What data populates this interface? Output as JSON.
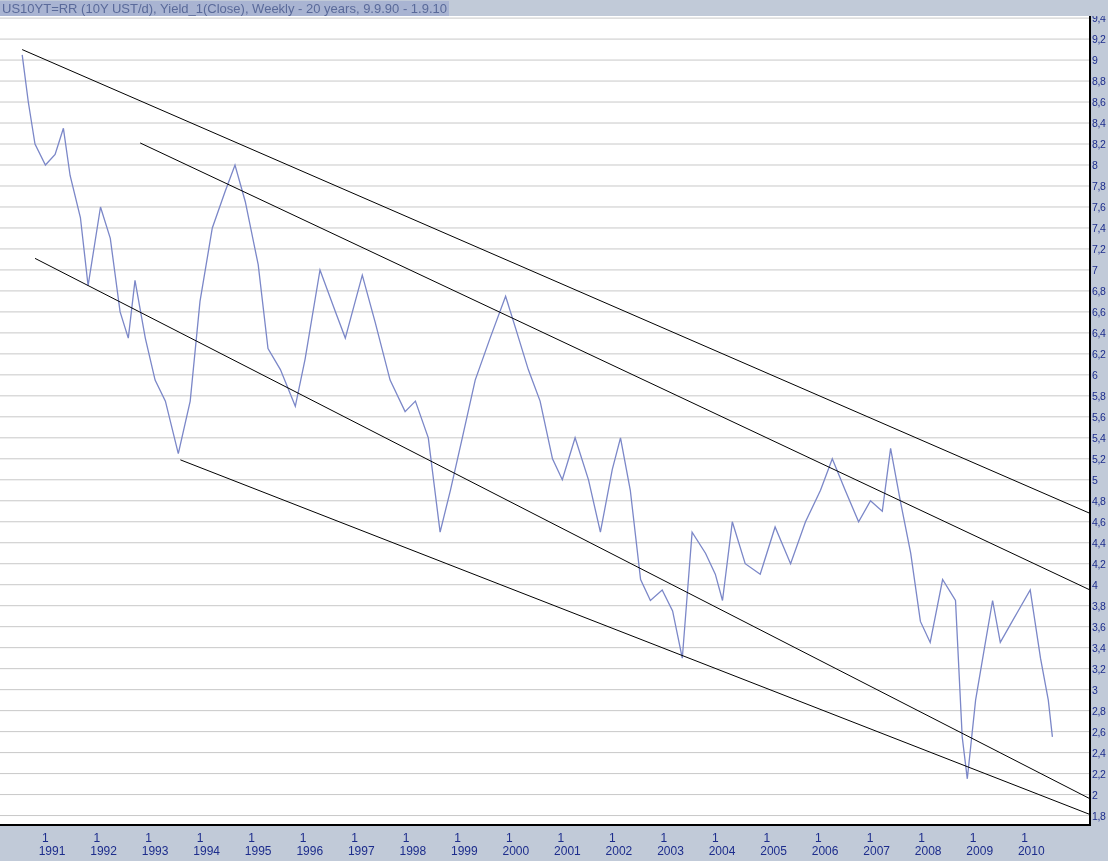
{
  "title_bar": {
    "text": "US10YT=RR (10Y UST/d), Yield_1(Close), Weekly - 20 years, 9.9.90 - 1.9.10"
  },
  "chart": {
    "chart_data": {
      "type": "line",
      "x": [
        1990.42,
        1990.54,
        1990.67,
        1990.87,
        1991.06,
        1991.22,
        1991.35,
        1991.55,
        1991.7,
        1991.94,
        1992.13,
        1992.32,
        1992.48,
        1992.61,
        1992.81,
        1993.0,
        1993.2,
        1993.45,
        1993.68,
        1993.87,
        1994.11,
        1994.36,
        1994.55,
        1994.75,
        1995.0,
        1995.19,
        1995.43,
        1995.72,
        1995.91,
        1996.2,
        1996.5,
        1996.69,
        1997.02,
        1997.27,
        1997.56,
        1997.85,
        1998.05,
        1998.3,
        1998.53,
        1998.73,
        1998.96,
        1999.21,
        1999.5,
        1999.8,
        1999.99,
        2000.24,
        2000.47,
        2000.71,
        2000.9,
        2001.15,
        2001.41,
        2001.64,
        2001.87,
        2002.03,
        2002.22,
        2002.42,
        2002.61,
        2002.84,
        2003.04,
        2003.23,
        2003.42,
        2003.68,
        2003.87,
        2004.01,
        2004.2,
        2004.45,
        2004.74,
        2005.03,
        2005.33,
        2005.62,
        2005.91,
        2006.14,
        2006.39,
        2006.65,
        2006.88,
        2007.11,
        2007.27,
        2007.46,
        2007.66,
        2007.85,
        2008.04,
        2008.28,
        2008.53,
        2008.66,
        2008.76,
        2008.92,
        2009.11,
        2009.25,
        2009.4,
        2009.63,
        2009.98,
        2010.18,
        2010.33,
        2010.41
      ],
      "series": [
        {
          "color": "#7b87c8",
          "values": [
            9.05,
            8.6,
            8.2,
            8.0,
            8.1,
            8.35,
            7.9,
            7.5,
            6.85,
            7.6,
            7.3,
            6.6,
            6.35,
            6.9,
            6.35,
            5.95,
            5.75,
            5.25,
            5.75,
            6.7,
            7.4,
            7.75,
            8.0,
            7.65,
            7.05,
            6.25,
            6.05,
            5.7,
            6.15,
            7.0,
            6.6,
            6.35,
            6.95,
            6.5,
            5.95,
            5.65,
            5.75,
            5.4,
            4.5,
            4.9,
            5.4,
            5.95,
            6.35,
            6.75,
            6.45,
            6.05,
            5.75,
            5.2,
            5.0,
            5.4,
            5.0,
            4.5,
            5.1,
            5.4,
            4.9,
            4.05,
            3.85,
            3.95,
            3.75,
            3.3,
            4.5,
            4.3,
            4.1,
            3.85,
            4.6,
            4.2,
            4.1,
            4.55,
            4.2,
            4.6,
            4.9,
            5.2,
            4.9,
            4.6,
            4.8,
            4.7,
            5.3,
            4.8,
            4.3,
            3.65,
            3.45,
            4.05,
            3.85,
            2.55,
            2.15,
            2.9,
            3.45,
            3.85,
            3.45,
            3.65,
            3.95,
            3.3,
            2.9,
            2.55
          ]
        }
      ],
      "xlim": [
        1989.99,
        2011.14
      ],
      "grid": true,
      "ylim": [
        1.71,
        9.42
      ],
      "yticks": [
        {
          "value": 9.4,
          "label": "9,4"
        },
        {
          "value": 9.2,
          "label": "9,2"
        },
        {
          "value": 9,
          "label": "9"
        },
        {
          "value": 8.8,
          "label": "8,8"
        },
        {
          "value": 8.6,
          "label": "8,6"
        },
        {
          "value": 8.4,
          "label": "8,4"
        },
        {
          "value": 8.2,
          "label": "8,2"
        },
        {
          "value": 8,
          "label": "8"
        },
        {
          "value": 7.8,
          "label": "7,8"
        },
        {
          "value": 7.6,
          "label": "7,6"
        },
        {
          "value": 7.4,
          "label": "7,4"
        },
        {
          "value": 7.2,
          "label": "7,2"
        },
        {
          "value": 7,
          "label": "7"
        },
        {
          "value": 6.8,
          "label": "6,8"
        },
        {
          "value": 6.6,
          "label": "6,6"
        },
        {
          "value": 6.4,
          "label": "6,4"
        },
        {
          "value": 6.2,
          "label": "6,2"
        },
        {
          "value": 6,
          "label": "6"
        },
        {
          "value": 5.8,
          "label": "5,8"
        },
        {
          "value": 5.6,
          "label": "5,6"
        },
        {
          "value": 5.4,
          "label": "5,4"
        },
        {
          "value": 5.2,
          "label": "5,2"
        },
        {
          "value": 5,
          "label": "5"
        },
        {
          "value": 4.8,
          "label": "4,8"
        },
        {
          "value": 4.6,
          "label": "4,6"
        },
        {
          "value": 4.4,
          "label": "4,4"
        },
        {
          "value": 4.2,
          "label": "4,2"
        },
        {
          "value": 4,
          "label": "4"
        },
        {
          "value": 3.8,
          "label": "3,8"
        },
        {
          "value": 3.6,
          "label": "3,6"
        },
        {
          "value": 3.4,
          "label": "3,4"
        },
        {
          "value": 3.2,
          "label": "3,2"
        },
        {
          "value": 3,
          "label": "3"
        },
        {
          "value": 2.8,
          "label": "2,8"
        },
        {
          "value": 2.6,
          "label": "2,6"
        },
        {
          "value": 2.4,
          "label": "2,4"
        },
        {
          "value": 2.2,
          "label": "2,2"
        },
        {
          "value": 2,
          "label": "2"
        },
        {
          "value": 1.8,
          "label": "1,8"
        }
      ],
      "xticks": [
        1991,
        1992,
        1993,
        1994,
        1995,
        1996,
        1997,
        1998,
        1999,
        2000,
        2001,
        2002,
        2003,
        2004,
        2005,
        2006,
        2007,
        2008,
        2009,
        2010
      ]
    },
    "x_axis_month_marks": [
      "1",
      "1",
      "1",
      "1",
      "1",
      "1",
      "1",
      "1",
      "1",
      "1",
      "1",
      "1",
      "1",
      "1",
      "1",
      "1",
      "1",
      "1",
      "1",
      "1"
    ]
  }
}
